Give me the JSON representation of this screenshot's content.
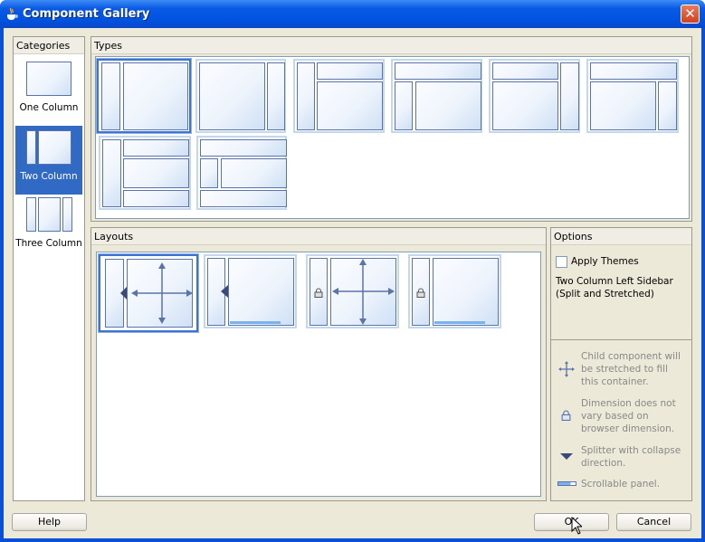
{
  "window": {
    "title": "Component Gallery",
    "close_icon": "close-icon"
  },
  "categories": {
    "header": "Categories",
    "items": [
      {
        "label": "One Column",
        "selected": false
      },
      {
        "label": "Two Column",
        "selected": true
      },
      {
        "label": "Three Column",
        "selected": false
      }
    ]
  },
  "types": {
    "header": "Types",
    "items": [
      {
        "name": "left-sidebar",
        "selected": true
      },
      {
        "name": "right-sidebar",
        "selected": false
      },
      {
        "name": "left-sidebar-top-header",
        "selected": false
      },
      {
        "name": "top-header-left-sidebar",
        "selected": false
      },
      {
        "name": "top-header-right-sidebar",
        "selected": false
      },
      {
        "name": "top-header-right-sidebar-full",
        "selected": false
      },
      {
        "name": "left-sidebar-header-footer",
        "selected": false
      },
      {
        "name": "header-left-sidebar-footer",
        "selected": false
      }
    ]
  },
  "layouts": {
    "header": "Layouts",
    "items": [
      {
        "name": "split-stretched",
        "selected": true
      },
      {
        "name": "split-scrollable",
        "selected": false
      },
      {
        "name": "fixed-stretched",
        "selected": false
      },
      {
        "name": "fixed-scrollable",
        "selected": false
      }
    ]
  },
  "options": {
    "header": "Options",
    "apply_themes_label": "Apply Themes",
    "apply_themes_checked": false,
    "description": "Two Column Left Sidebar (Split and Stretched)"
  },
  "legend": [
    {
      "icon": "stretch-arrows-icon",
      "text": "Child component will be stretched to fill this container."
    },
    {
      "icon": "lock-icon",
      "text": "Dimension does not vary based on browser dimension."
    },
    {
      "icon": "splitter-icon",
      "text": "Splitter with collapse direction."
    },
    {
      "icon": "scrollbar-icon",
      "text": "Scrollable panel."
    }
  ],
  "buttons": {
    "help": "Help",
    "ok": "OK",
    "cancel": "Cancel"
  }
}
